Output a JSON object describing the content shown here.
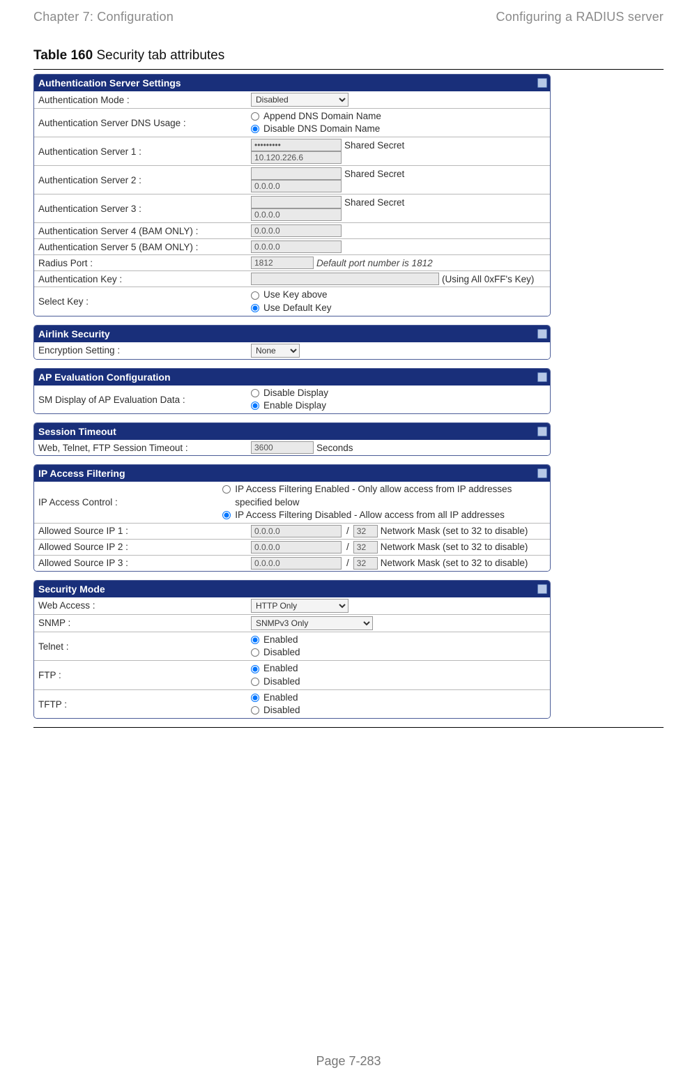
{
  "header": {
    "left": "Chapter 7:  Configuration",
    "right": "Configuring a RADIUS server"
  },
  "footer": "Page 7-283",
  "caption": {
    "strong": "Table 160",
    "rest": " Security tab attributes"
  },
  "auth": {
    "title": "Authentication Server Settings",
    "mode_label": "Authentication Mode :",
    "mode_value": "Disabled",
    "dns_label": "Authentication Server DNS Usage :",
    "dns_opt1": "Append DNS Domain Name",
    "dns_opt2": "Disable DNS Domain Name",
    "s1_label": "Authentication Server 1 :",
    "s1_secret": "Shared Secret",
    "s1_ip": "10.120.226.6",
    "s2_label": "Authentication Server 2 :",
    "s2_secret": "Shared Secret",
    "s2_ip": "0.0.0.0",
    "s3_label": "Authentication Server 3 :",
    "s3_secret": "Shared Secret",
    "s3_ip": "0.0.0.0",
    "s4_label": "Authentication Server 4 (BAM ONLY) :",
    "s4_ip": "0.0.0.0",
    "s5_label": "Authentication Server 5 (BAM ONLY) :",
    "s5_ip": "0.0.0.0",
    "port_label": "Radius Port :",
    "port_value": "1812",
    "port_hint": "Default port number is 1812",
    "key_label": "Authentication Key :",
    "key_hint": "(Using All 0xFF's Key)",
    "sel_label": "Select Key :",
    "sel_opt1": "Use Key above",
    "sel_opt2": "Use Default Key"
  },
  "airlink": {
    "title": "Airlink Security",
    "enc_label": "Encryption Setting :",
    "enc_value": "None"
  },
  "apeval": {
    "title": "AP Evaluation Configuration",
    "label": "SM Display of AP Evaluation Data :",
    "opt1": "Disable Display",
    "opt2": "Enable Display"
  },
  "session": {
    "title": "Session Timeout",
    "label": "Web, Telnet, FTP Session Timeout :",
    "value": "3600",
    "unit": "Seconds"
  },
  "ipfilter": {
    "title": "IP Access Filtering",
    "ctrl_label": "IP Access Control :",
    "opt1": "IP Access Filtering Enabled - Only allow access from IP addresses specified below",
    "opt2": "IP Access Filtering Disabled - Allow access from all IP addresses",
    "src1_label": "Allowed Source IP 1 :",
    "src2_label": "Allowed Source IP 2 :",
    "src3_label": "Allowed Source IP 3 :",
    "ip": "0.0.0.0",
    "mask": "32",
    "mask_hint": "Network Mask (set to 32 to disable)"
  },
  "secmode": {
    "title": "Security Mode",
    "web_label": "Web Access :",
    "web_value": "HTTP Only",
    "snmp_label": "SNMP :",
    "snmp_value": "SNMPv3 Only",
    "telnet_label": "Telnet :",
    "ftp_label": "FTP :",
    "tftp_label": "TFTP :",
    "en": "Enabled",
    "dis": "Disabled"
  }
}
